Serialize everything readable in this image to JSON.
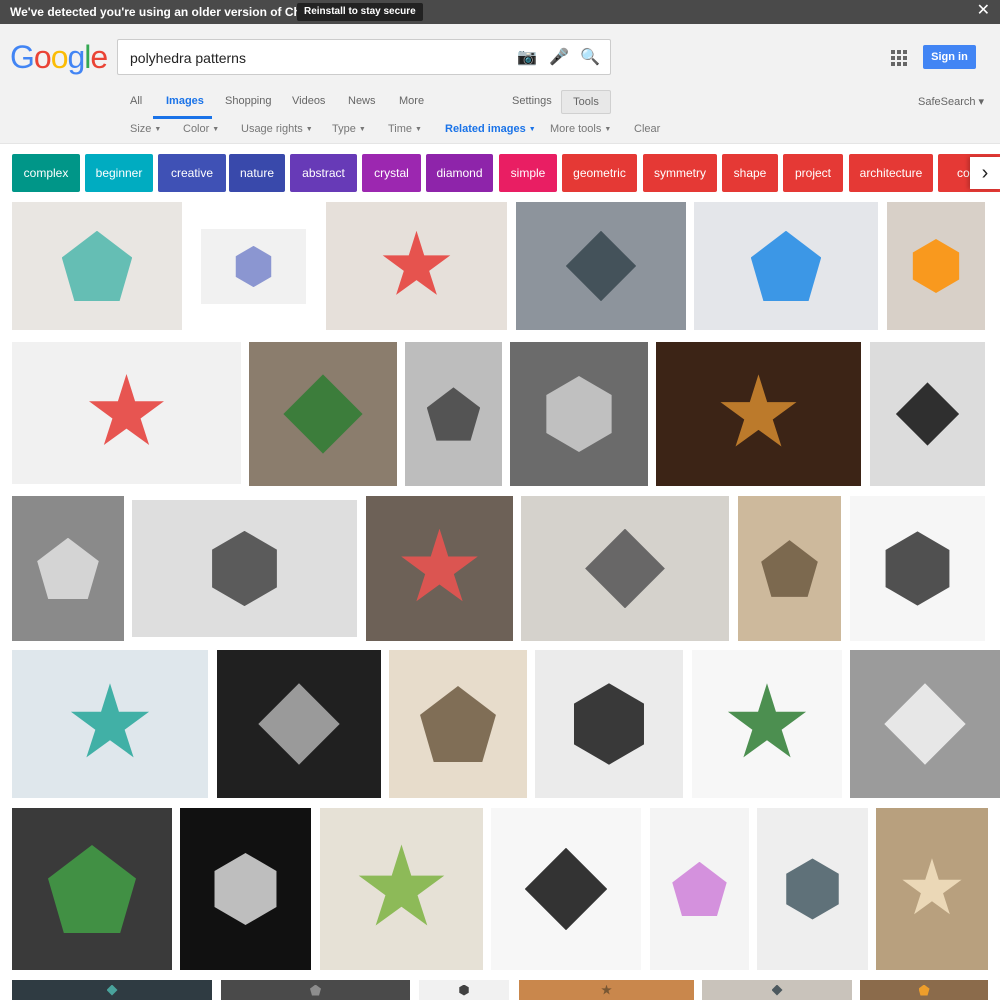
{
  "banner": {
    "message": "We've detected you're using an older version of Chrome.",
    "button": "Reinstall to stay secure",
    "close": "✕"
  },
  "logo": [
    "G",
    "o",
    "o",
    "g",
    "l",
    "e"
  ],
  "search": {
    "query": "polyhedra patterns",
    "camera_icon": "📷",
    "mic_icon": "🎤",
    "search_icon": "🔍"
  },
  "header": {
    "signin": "Sign in",
    "settings": "Settings",
    "tools": "Tools",
    "safesearch": "SafeSearch ▾"
  },
  "tabs": [
    "All",
    "Images",
    "Shopping",
    "Videos",
    "News",
    "More"
  ],
  "filters": [
    {
      "label": "Size"
    },
    {
      "label": "Color"
    },
    {
      "label": "Usage rights"
    },
    {
      "label": "Type"
    },
    {
      "label": "Time"
    },
    {
      "label": "Related images"
    },
    {
      "label": "More tools"
    },
    {
      "label": "Clear"
    }
  ],
  "chips": [
    {
      "label": "complex",
      "color": "#009688"
    },
    {
      "label": "beginner",
      "color": "#00acc1"
    },
    {
      "label": "creative",
      "color": "#3f51b5"
    },
    {
      "label": "nature",
      "color": "#3949ab"
    },
    {
      "label": "abstract",
      "color": "#673ab7"
    },
    {
      "label": "crystal",
      "color": "#9c27b0"
    },
    {
      "label": "diamond",
      "color": "#8e24aa"
    },
    {
      "label": "simple",
      "color": "#e91e63"
    },
    {
      "label": "geometric",
      "color": "#e53935"
    },
    {
      "label": "symmetry",
      "color": "#e53935"
    },
    {
      "label": "shape",
      "color": "#e53935"
    },
    {
      "label": "project",
      "color": "#e53935"
    },
    {
      "label": "architecture",
      "color": "#e53935"
    },
    {
      "label": "compu",
      "color": "#e53935"
    }
  ],
  "results": [
    {
      "bg": "#e9e6e2",
      "fg": "#4db6ac"
    },
    {
      "bg": "#f1f1f1",
      "fg": "#7986cb"
    },
    {
      "bg": "#e6e0da",
      "fg": "#e53935"
    },
    {
      "bg": "#8d949c",
      "fg": "#37474f"
    },
    {
      "bg": "#e4e6ea",
      "fg": "#1e88e5"
    },
    {
      "bg": "#d8d0c8",
      "fg": "#ff8f00"
    },
    {
      "bg": "#f1f1f1",
      "fg": "#e53935"
    },
    {
      "bg": "#8b7d6d",
      "fg": "#2e7d32"
    },
    {
      "bg": "#bdbdbd",
      "fg": "#424242"
    },
    {
      "bg": "#6b6b6b",
      "fg": "#cfcfcf"
    },
    {
      "bg": "#3c2416",
      "fg": "#d28a2f"
    },
    {
      "bg": "#dcdcdc",
      "fg": "#111111"
    },
    {
      "bg": "#8a8a8a",
      "fg": "#e0e0e0"
    },
    {
      "bg": "#dedede",
      "fg": "#444444"
    },
    {
      "bg": "#6d6157",
      "fg": "#ef5350"
    },
    {
      "bg": "#d5d2cc",
      "fg": "#555555"
    },
    {
      "bg": "#cdb99c",
      "fg": "#6d5b42"
    },
    {
      "bg": "#f6f6f6",
      "fg": "#333333"
    },
    {
      "bg": "#dfe7ec",
      "fg": "#26a69a"
    },
    {
      "bg": "#202020",
      "fg": "#b0b0b0"
    },
    {
      "bg": "#e7dccb",
      "fg": "#6d5b42"
    },
    {
      "bg": "#ebebeb",
      "fg": "#1a1a1a"
    },
    {
      "bg": "#f7f7f7",
      "fg": "#2e7d32"
    },
    {
      "bg": "#9b9b9b",
      "fg": "#f5f5f5"
    },
    {
      "bg": "#3a3a3a",
      "fg": "#43a047"
    },
    {
      "bg": "#111111",
      "fg": "#dddddd"
    },
    {
      "bg": "#e6e1d6",
      "fg": "#7cb342"
    },
    {
      "bg": "#f7f7f7",
      "fg": "#111111"
    },
    {
      "bg": "#f4f4f4",
      "fg": "#ce7fd8"
    },
    {
      "bg": "#eeeeee",
      "fg": "#455a64"
    },
    {
      "bg": "#b8a07e",
      "fg": "#f3e2c1"
    },
    {
      "bg": "#2f3b42",
      "fg": "#4db6ac"
    },
    {
      "bg": "#4a4a4a",
      "fg": "#999999"
    },
    {
      "bg": "#f1f1f1",
      "fg": "#222222"
    },
    {
      "bg": "#c9874c",
      "fg": "#6b4f2f"
    },
    {
      "bg": "#c9c3bb",
      "fg": "#37474f"
    },
    {
      "bg": "#8b6b4b",
      "fg": "#ffa726"
    },
    {
      "bg": "#d6dbe0",
      "fg": "#455a64"
    }
  ]
}
